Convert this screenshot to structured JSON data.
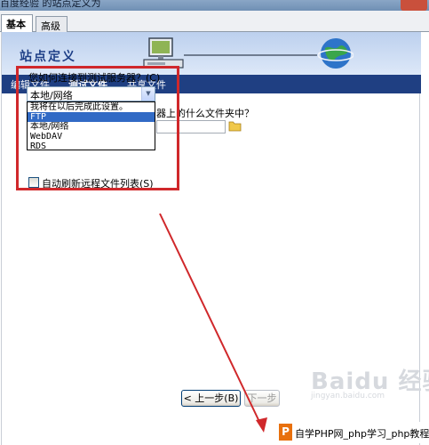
{
  "window": {
    "title": "百度经验 的站点定义为"
  },
  "tabs": {
    "basic": "基本",
    "advanced": "高级"
  },
  "banner": {
    "title": "站点定义"
  },
  "nav": {
    "items": [
      {
        "label": "编辑文件",
        "active": false
      },
      {
        "label": "测试文件",
        "active": true
      },
      {
        "label": "共享文件",
        "active": false
      }
    ]
  },
  "form": {
    "connect_question": "您如何连接到测试服务器？(C)",
    "connect_selected": "本地/网络",
    "dropdown_options": [
      "我将在以后完成此设置。",
      "FTP",
      "本地/网络",
      "WebDAV",
      "RDS"
    ],
    "dropdown_highlighted": "FTP",
    "folder_question": "器上的什么文件夹中？",
    "folder_value": "",
    "refresh_checkbox_label": "自动刷新远程文件列表(S)",
    "refresh_checked": false
  },
  "buttons": {
    "prev": "< 上一步(B)",
    "next": "下一步"
  },
  "watermark": {
    "logo": "Baidu 经验",
    "url": "jingyan.baidu.com"
  },
  "corner_banner": {
    "logo": "P",
    "text": "自学PHP网_php学习_php教程"
  },
  "colors": {
    "accent_nav": "#1f3f82",
    "highlight_box": "#d0282b",
    "arrow": "#d0282b",
    "selection": "#316ac5"
  }
}
